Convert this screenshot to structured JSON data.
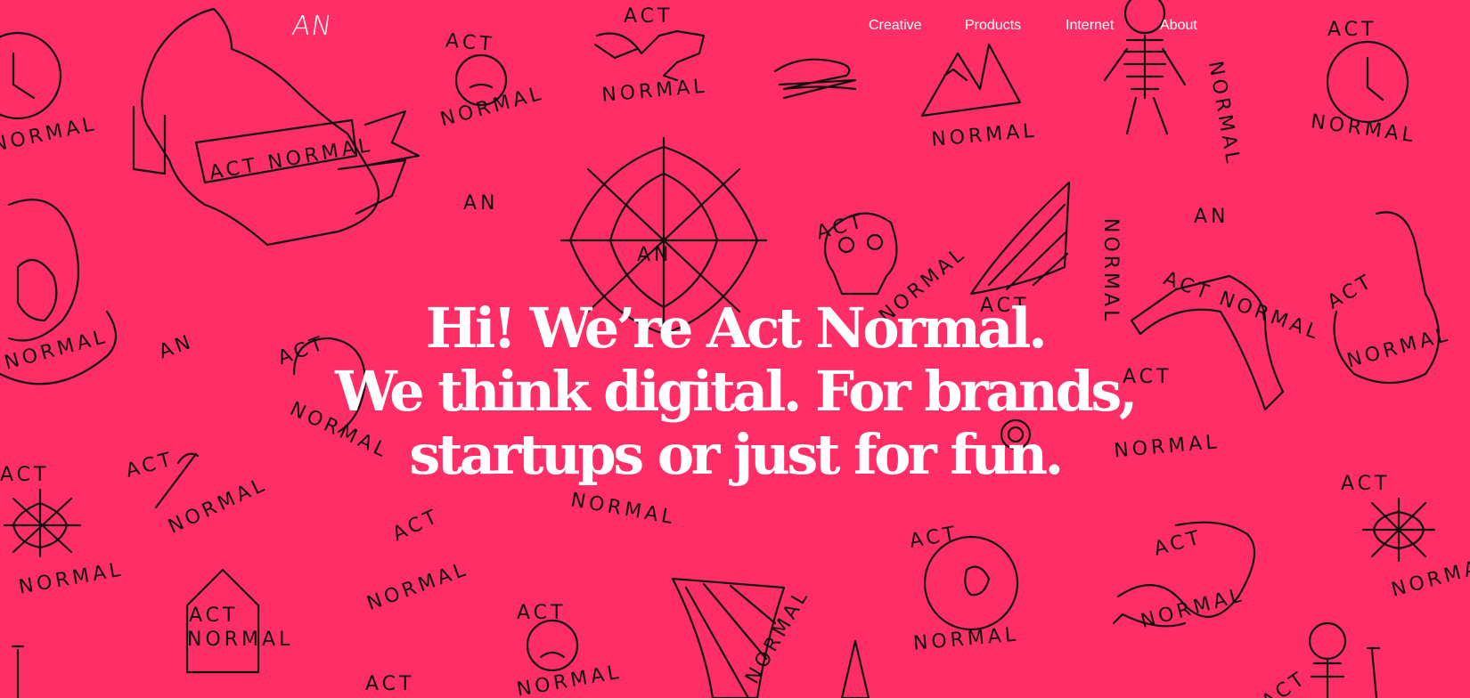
{
  "brand": {
    "logo": "AN"
  },
  "nav": {
    "items": [
      {
        "label": "Creative"
      },
      {
        "label": "Products"
      },
      {
        "label": "Internet"
      },
      {
        "label": "About"
      }
    ]
  },
  "hero": {
    "line1": "Hi! We’re Act Normal.",
    "line2": "We think digital. For brands,",
    "line3": "startups or just for fun."
  },
  "background": {
    "color": "#ff2e67",
    "doodle_words": {
      "act": "ACT",
      "normal": "NORMAL",
      "act_normal": "ACT NORMAL",
      "an": "AN"
    }
  }
}
